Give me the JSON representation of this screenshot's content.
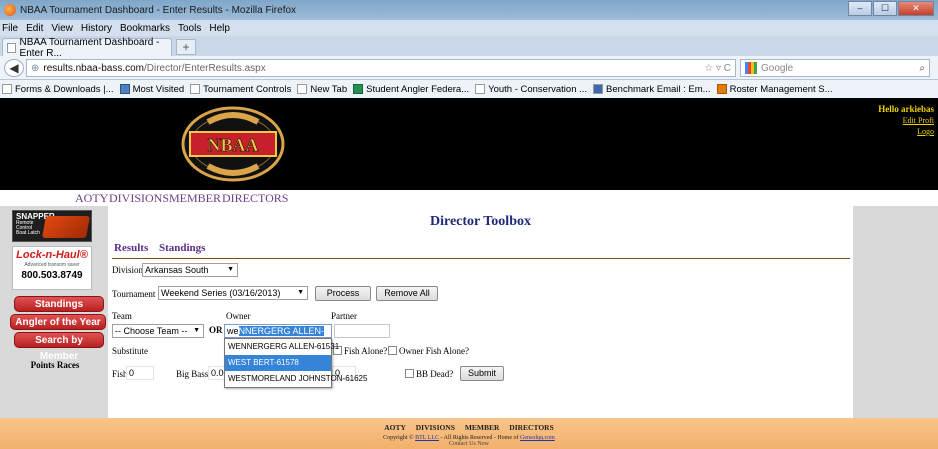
{
  "window": {
    "title": "NBAA Tournament Dashboard - Enter Results - Mozilla Firefox",
    "controls": [
      "–",
      "☐",
      "✕"
    ]
  },
  "menu": [
    "File",
    "Edit",
    "View",
    "History",
    "Bookmarks",
    "Tools",
    "Help"
  ],
  "tab": {
    "label": "NBAA Tournament Dashboard - Enter R...",
    "new_tab": "+"
  },
  "nav": {
    "url_host": "results.nbaa-bass.com",
    "url_path": "/Director/EnterResults.aspx",
    "search_placeholder": "Google"
  },
  "bookmarks": [
    {
      "label": "Forms & Downloads |...",
      "icon": "page-icon"
    },
    {
      "label": "Most Visited",
      "icon": "folder-icon"
    },
    {
      "label": "Tournament Controls",
      "icon": "page-icon"
    },
    {
      "label": "New Tab",
      "icon": "page-icon"
    },
    {
      "label": "Student Angler Federa...",
      "icon": "page-icon"
    },
    {
      "label": "Youth - Conservation ...",
      "icon": "page-icon"
    },
    {
      "label": "Benchmark Email : Em...",
      "icon": "page-icon"
    },
    {
      "label": "Roster Management S...",
      "icon": "page-icon"
    }
  ],
  "header": {
    "logo_text": "NBAA",
    "hello_text": "Hello arkiebas",
    "edit_profile": "Edit Profi",
    "logout": "Logo"
  },
  "topnav": [
    "AOTY",
    "DIVISIONS",
    "MEMBER",
    "DIRECTORS"
  ],
  "sidebar": {
    "snapper_title": "SNAPPER",
    "snapper_sub": "Remote Control Boat Latch",
    "lock_title": "Lock-n-Haul®",
    "lock_sub": "Advanced transom saver",
    "lock_phone": "800.503.8749",
    "buttons": [
      "Standings",
      "Angler of the Year",
      "Search by Member"
    ],
    "points_races": "Points Races"
  },
  "toolbox": {
    "title": "Director Toolbox",
    "links": [
      "Results",
      "Standings"
    ],
    "division_label": "Division",
    "division_value": "Arkansas South",
    "tournament_label": "Tournament",
    "tournament_value": "Weekend Series (03/16/2013)",
    "process_button": "Process",
    "remove_all_button": "Remove All",
    "team_label": "Team",
    "owner_label": "Owner",
    "partner_label": "Partner",
    "team_value": "-- Choose Team --",
    "or_label": "OR",
    "owner_typed": "we",
    "owner_autocomplete": "NNERGERG ALLEN-61531",
    "substitute_label": "Substitute",
    "fish_alone_label": "Fish Alone?",
    "owner_fish_alone_label": "Owner Fish Alone?",
    "fish_label": "Fish",
    "fish_value": "0",
    "big_bass_label": "Big Bass",
    "big_bass_value": "0.00",
    "partner_value": "0",
    "bb_dead_label": "BB Dead?",
    "submit_button": "Submit",
    "suggestions": [
      "WENNERGERG ALLEN-61531",
      "WEST BERT-61578",
      "WESTMORELAND JOHNSTON-61625"
    ]
  },
  "footer": {
    "nav": [
      "AOTY",
      "DIVISIONS",
      "MEMBER",
      "DIRECTORS"
    ],
    "copyright_prefix": "Copyright ©",
    "copyright_link": "BTL LLC",
    "copyright_mid": "- All Rights Reserved - Home of",
    "copyright_home": "Gensolqq.com",
    "contact": "Contact Us Now"
  }
}
